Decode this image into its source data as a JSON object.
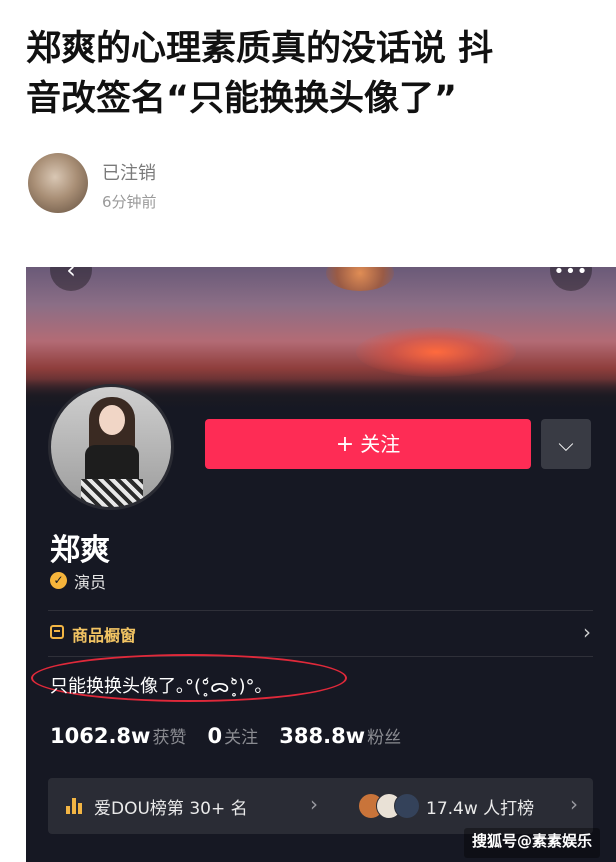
{
  "article": {
    "title_line1": "郑爽的心理素质真的没话说 抖",
    "title_line2": "音改签名“只能换换头像了”",
    "author_name": "已注销",
    "time": "6分钟前"
  },
  "profile": {
    "back_icon": "‹",
    "more_icon": "•••",
    "follow_plus": "+",
    "follow_label": "关注",
    "dropdown_icon": "⌵",
    "name": "郑爽",
    "verify_mark": "✓",
    "verify_text": "演员",
    "shop_label": "商品橱窗",
    "shop_chevron": "›",
    "bio": "只能换换头像了｡°(°̥́ᯅ°̥̀)°｡",
    "highlight_color": "#e0293a",
    "stats": {
      "likes_value": "1062.8w",
      "likes_label": "获赞",
      "following_value": "0",
      "following_label": "关注",
      "fans_value": "388.8w",
      "fans_label": "粉丝"
    },
    "rank": {
      "text": "爱DOU榜第 30+ 名",
      "chevron": "›",
      "fans_text": "17.4w 人打榜",
      "chevron2": "›"
    }
  },
  "watermark": "搜狐号@素素娱乐",
  "colors": {
    "follow": "#fe2c55",
    "background": "#161823",
    "gold": "#f2b544"
  }
}
